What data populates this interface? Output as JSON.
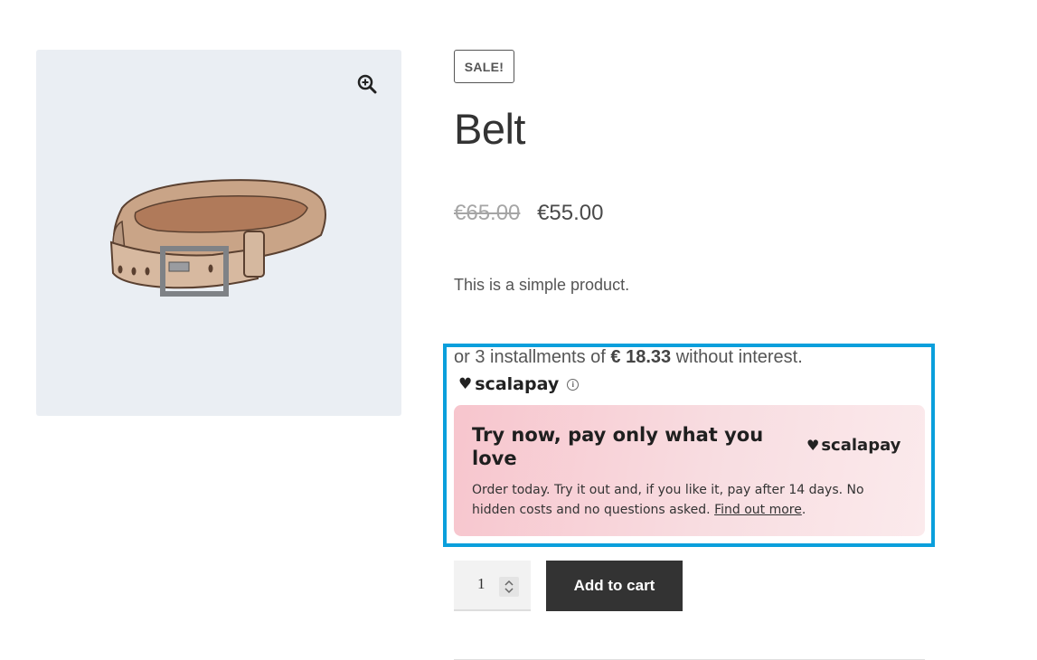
{
  "product": {
    "sale_badge": "SALE!",
    "title": "Belt",
    "price_old": "€65.00",
    "price_new": "€55.00",
    "description": "This is a simple product."
  },
  "scalapay": {
    "installments_prefix": "or 3 installments of ",
    "installments_amount": "€ 18.33",
    "installments_suffix": " without interest.",
    "brand": "scalapay",
    "info_icon": "i",
    "banner": {
      "title": "Try now, pay only what you love",
      "brand": "scalapay",
      "text": "Order today. Try it out and, if you like it, pay after 14 days. No hidden costs and no questions asked. ",
      "link": "Find out more",
      "trailing": "."
    }
  },
  "cart": {
    "quantity": "1",
    "add_label": "Add to cart"
  },
  "icons": {
    "zoom": "zoom-in-icon",
    "heart": "heart-icon",
    "info": "info-icon",
    "spinner": "spinner-arrows-icon"
  },
  "colors": {
    "highlight": "#0a9fdc",
    "button": "#333333",
    "banner_pink": "#f7c5cd",
    "gallery_bg": "#eaeef3"
  }
}
